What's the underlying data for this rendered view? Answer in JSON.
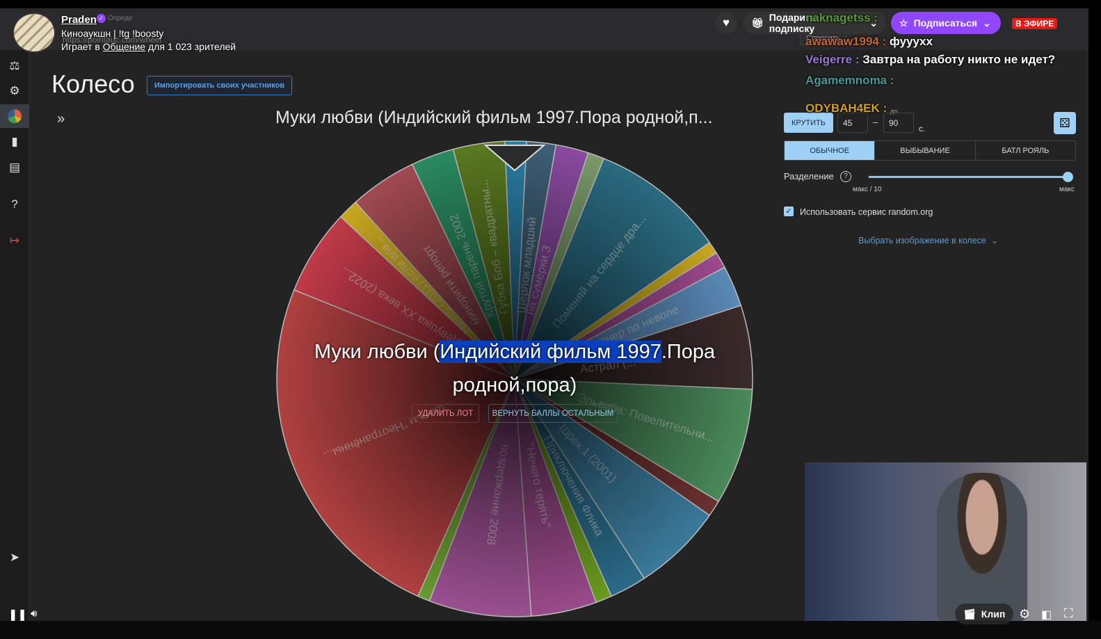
{
  "stream": {
    "channel": "Praden",
    "tab_fragment": "Опреде",
    "title": "Киноаукшн | !tg !boosty",
    "playing_prefix": "Играет в",
    "category": "Общение",
    "viewers_suffix": "для 1 023 зрителей",
    "gift_label": "Подарить подписку",
    "subscribe_label": "Подписаться",
    "live_label": "В ЭФИРЕ",
    "clip_label": "Клип",
    "accent": "#9147ff"
  },
  "browser": {
    "url": "https://pointauc.com/wheel",
    "ask_label": "Спросить"
  },
  "chat": [
    {
      "user": "naknagetss",
      "text": "",
      "color": "#5a9a3a"
    },
    {
      "user": "awawaw1994",
      "text": "фуууxx",
      "color": "#c06a3a"
    },
    {
      "user": "Veigerre",
      "text": "Завтра на работу никто не идет?",
      "color": "#9a7ad0"
    },
    {
      "user": "Agamemnoma",
      "text": "",
      "color": "#4a9a9a"
    },
    {
      "user": "ODYBAH4EK",
      "text": "",
      "color": "#d0a020"
    }
  ],
  "page": {
    "title": "Колесо",
    "import_label": "Импортировать своих участников",
    "winner_header": "Муки любви (Индийский фильм 1997.Пора родной,п...",
    "winner_a": "Муки любви (",
    "winner_hl": "Индийский фильм 1997",
    "winner_b": ".Пора",
    "winner_line2": "родной,пора)",
    "delete_label": "УДАЛИТЬ ЛОТ",
    "return_label": "ВЕРНУТЬ БАЛЛЫ ОСТАЛЬНЫМ",
    "expand": "»"
  },
  "controls": {
    "spin_label": "КРУТИТЬ",
    "min": "45",
    "dash": "–",
    "max": "90",
    "to_label": "до",
    "unit": "с.",
    "modes": [
      "ОБЫЧНОЕ",
      "ВЫБЫВАНИЕ",
      "БАТЛ РОЯЛЬ"
    ],
    "active_mode": 0,
    "split_label": "Разделение",
    "split_min": "макс / 10",
    "split_max": "макс",
    "split_value": 1.0,
    "random_org_label": "Использовать сервис random.org",
    "random_org_checked": true,
    "image_select_label": "Выбрать изображение в колесе"
  },
  "wheel": [
    {
      "label": "",
      "color": "#2a7fa8",
      "start": 357.6,
      "end": 362.9
    },
    {
      "label": "Шерлок младший",
      "color": "#3e5f78",
      "start": 2.9,
      "end": 10
    },
    {
      "label": "на сумерки 3",
      "color": "#8a4aa0",
      "start": 10,
      "end": 18
    },
    {
      "label": "",
      "color": "#7a9a6a",
      "start": 18,
      "end": 22
    },
    {
      "label": "Поменяй на сердце дра...",
      "color": "#2a6a80",
      "start": 22,
      "end": 55
    },
    {
      "label": "",
      "color": "#c9a820",
      "start": 55,
      "end": 58
    },
    {
      "label": "",
      "color": "#a04a90",
      "start": 58,
      "end": 62
    },
    {
      "label": "иллионер по неволе",
      "color": "#5a8ab8",
      "start": 62,
      "end": 72
    },
    {
      "label": "Астрал (...",
      "color": "#3a2a2a",
      "start": 72,
      "end": 92.5
    },
    {
      "label": "Эльвира: Повелительни...",
      "color": "#4a8a5a",
      "start": 92.5,
      "end": 121
    },
    {
      "label": "",
      "color": "#6a3030",
      "start": 121,
      "end": 125
    },
    {
      "label": "Шрек 1 (2001)",
      "color": "#3a7a9a",
      "start": 125,
      "end": 147
    },
    {
      "label": "Приключения Флика",
      "color": "#2a6a88",
      "start": 147,
      "end": 156
    },
    {
      "label": "",
      "color": "#6a9a20",
      "start": 156,
      "end": 160
    },
    {
      "label": "\"Нечего терять\"",
      "color": "#9a4a8a",
      "start": 160,
      "end": 176
    },
    {
      "label": "воздержание 2008",
      "color": "#9a5090",
      "start": 176,
      "end": 201
    },
    {
      "label": "",
      "color": "#6a9a30",
      "start": 201,
      "end": 204
    },
    {
      "label": "...фильм \"Неотранённы...",
      "color": "#b04040",
      "start": 204,
      "end": 292
    },
    {
      "label": "Девушка XX века (2022...",
      "color": "#c03a48",
      "start": 292,
      "end": 313
    },
    {
      "label": "Нечто (2011) если вла...",
      "color": "#c9a820",
      "start": 313,
      "end": 318
    },
    {
      "label": "минорити репорт",
      "color": "#a04a50",
      "start": 318,
      "end": 334.5
    },
    {
      "label": "Крутой парень 2002",
      "color": "#2a8a60",
      "start": 334.5,
      "end": 345
    },
    {
      "label": "Губка Боб – квадратны...",
      "color": "#5a7a20",
      "start": 345,
      "end": 357.6
    }
  ]
}
